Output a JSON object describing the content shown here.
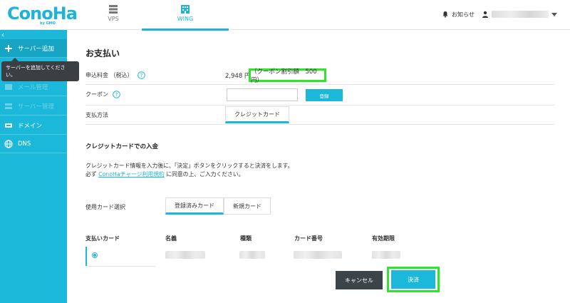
{
  "header": {
    "logo": "ConoHa",
    "logo_sub": "by GMO",
    "tabs": [
      {
        "label": "VPS",
        "icon": "server-icon"
      },
      {
        "label": "WING",
        "icon": "building-icon"
      }
    ],
    "notice_label": "お知らせ",
    "accent": "#1fb4d6"
  },
  "sidebar": {
    "collapse_glyph": "‹",
    "items": [
      {
        "label": "サーバー追加",
        "icon": "plus-icon"
      },
      {
        "label": "メール管理",
        "icon": "mail-icon"
      },
      {
        "label": "サーバー管理",
        "icon": "server-icon"
      },
      {
        "label": "ドメイン",
        "icon": "domain-icon"
      },
      {
        "label": "DNS",
        "icon": "globe-icon"
      }
    ],
    "tooltip": "サーバーを追加してください。"
  },
  "main": {
    "title": "お支払い",
    "fee_label": "申込料金 （税込）",
    "fee_price": "2,948 円",
    "coupon_discount": "（クーポン割引額　500 円）",
    "coupon_label": "クーポン",
    "coupon_value": "",
    "register_label": "登録",
    "payment_method_label": "支払方法",
    "payment_method_tab": "クレジットカード",
    "section_title": "クレジットカードでの入金",
    "desc_line1": "クレジットカード情報を入力後に、「決定」ボタンをクリックすると決済をします。",
    "desc_prefix": "必ず ",
    "desc_link": "ConoHaチャージ利用規約",
    "desc_suffix": " に同意の上、ご入力ください。",
    "card_select_label": "使用カード選択",
    "card_tabs": [
      "登録済みカード",
      "新規カード"
    ],
    "table_headers": [
      "支払いカード",
      "名義",
      "種類",
      "カード番号",
      "有効期限"
    ],
    "cancel_label": "キャンセル",
    "confirm_label": "決済",
    "highlight_color": "#2ee628"
  }
}
